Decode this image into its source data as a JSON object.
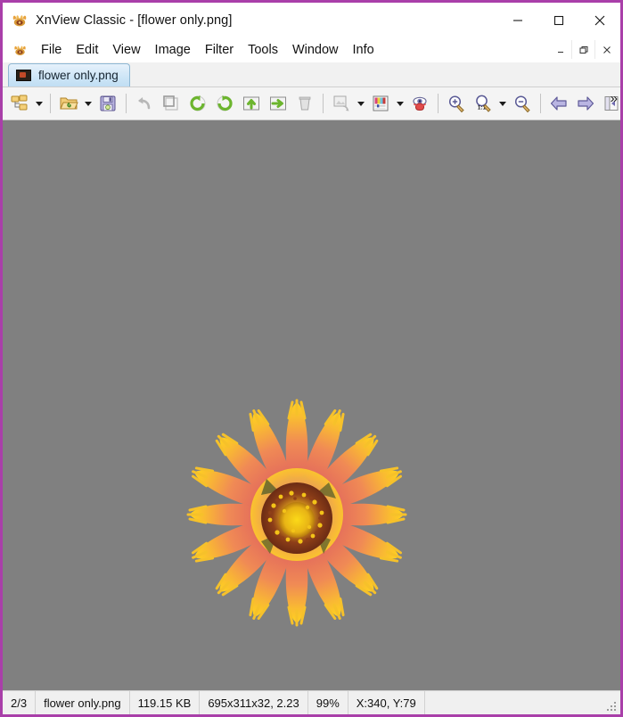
{
  "window": {
    "title": "XnView Classic - [flower only.png]",
    "app_icon": "xnview-butterfly-icon",
    "border_color": "#a93fa9",
    "controls": {
      "minimize": "minimize-icon",
      "maximize": "maximize-icon",
      "close": "close-icon"
    },
    "mdi_controls": {
      "minimize": "_",
      "restore": "restore-icon",
      "close": "x"
    }
  },
  "menubar": {
    "icon": "xnview-butterfly-icon",
    "items": [
      {
        "label": "File"
      },
      {
        "label": "Edit"
      },
      {
        "label": "View"
      },
      {
        "label": "Image"
      },
      {
        "label": "Filter"
      },
      {
        "label": "Tools"
      },
      {
        "label": "Window"
      },
      {
        "label": "Info"
      }
    ]
  },
  "tabs": [
    {
      "label": "flower only.png",
      "active": true,
      "icon": "image-thumbnail-icon"
    }
  ],
  "toolbar": {
    "overflow_label": "»",
    "buttons": [
      {
        "name": "browser-button",
        "icon": "folder-tree-icon",
        "enabled": true,
        "caret": true
      },
      {
        "name": "open-button",
        "icon": "open-folder-icon",
        "enabled": true,
        "caret": true
      },
      {
        "name": "save-button",
        "icon": "floppy-save-icon",
        "enabled": true,
        "caret": false
      },
      {
        "name": "undo-button",
        "icon": "undo-arrow-icon",
        "enabled": false,
        "caret": false
      },
      {
        "name": "crop-button",
        "icon": "crop-icon",
        "enabled": false,
        "caret": false
      },
      {
        "name": "rotate-left-button",
        "icon": "rotate-left-icon",
        "enabled": true,
        "caret": false
      },
      {
        "name": "rotate-right-button",
        "icon": "rotate-right-icon",
        "enabled": true,
        "caret": false
      },
      {
        "name": "export-up-button",
        "icon": "export-up-icon",
        "enabled": true,
        "caret": false
      },
      {
        "name": "export-right-button",
        "icon": "export-right-icon",
        "enabled": true,
        "caret": false
      },
      {
        "name": "delete-button",
        "icon": "trash-icon",
        "enabled": false,
        "caret": false
      },
      {
        "name": "resize-button",
        "icon": "resize-image-icon",
        "enabled": false,
        "caret": true
      },
      {
        "name": "adjust-colors-button",
        "icon": "color-levels-icon",
        "enabled": true,
        "caret": true
      },
      {
        "name": "red-eye-button",
        "icon": "red-eye-icon",
        "enabled": true,
        "caret": false
      },
      {
        "name": "zoom-in-button",
        "icon": "zoom-in-icon",
        "enabled": true,
        "caret": false
      },
      {
        "name": "actual-size-button",
        "icon": "zoom-1to1-icon",
        "enabled": true,
        "caret": true
      },
      {
        "name": "zoom-out-button",
        "icon": "zoom-out-icon",
        "enabled": true,
        "caret": false
      },
      {
        "name": "previous-image-button",
        "icon": "arrow-left-icon",
        "enabled": true,
        "caret": false
      },
      {
        "name": "next-image-button",
        "icon": "arrow-right-icon",
        "enabled": true,
        "caret": false
      },
      {
        "name": "toggle-panel-button",
        "icon": "panel-toggle-icon",
        "enabled": true,
        "caret": false
      }
    ]
  },
  "canvas": {
    "background_color": "#808080",
    "image_name": "flower only.png",
    "image_alt": "blanket-flower-gaillardia-photo"
  },
  "statusbar": {
    "index": "2/3",
    "filename": "flower only.png",
    "filesize": "119.15 KB",
    "dimensions": "695x311x32, 2.23",
    "zoom": "99%",
    "cursor": "X:340, Y:79",
    "grip": "resize-grip-icon"
  }
}
